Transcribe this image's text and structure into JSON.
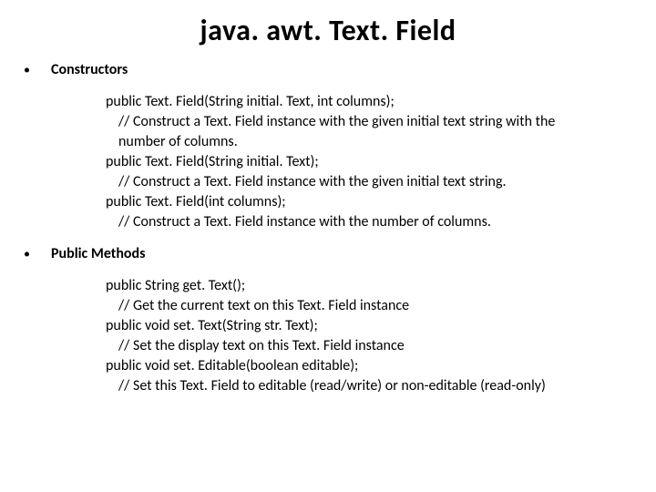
{
  "title": "java. awt. Text. Field",
  "sections": {
    "constructors": {
      "bullet": "•",
      "label": "Constructors",
      "items": {
        "c1_sig": "public Text. Field(String initial. Text, int columns);",
        "c1_desc1": "// Construct a Text. Field instance with the given initial text string with the",
        "c1_desc2": "number of columns.",
        "c2_sig": "public Text. Field(String initial. Text);",
        "c2_desc": "// Construct a Text. Field instance with the given initial text string.",
        "c3_sig": "public Text. Field(int columns);",
        "c3_desc": "// Construct a Text. Field instance with the number of columns."
      }
    },
    "methods": {
      "bullet": "•",
      "label": "Public Methods",
      "items": {
        "m1_sig": "public String get. Text();",
        "m1_desc": "// Get the current text on this Text. Field instance",
        "m2_sig": "public void set. Text(String str. Text);",
        "m2_desc": "// Set the display text on this Text. Field instance",
        "m3_sig": "public void set. Editable(boolean editable);",
        "m3_desc": "// Set this Text. Field to editable (read/write) or non-editable (read-only)"
      }
    }
  }
}
